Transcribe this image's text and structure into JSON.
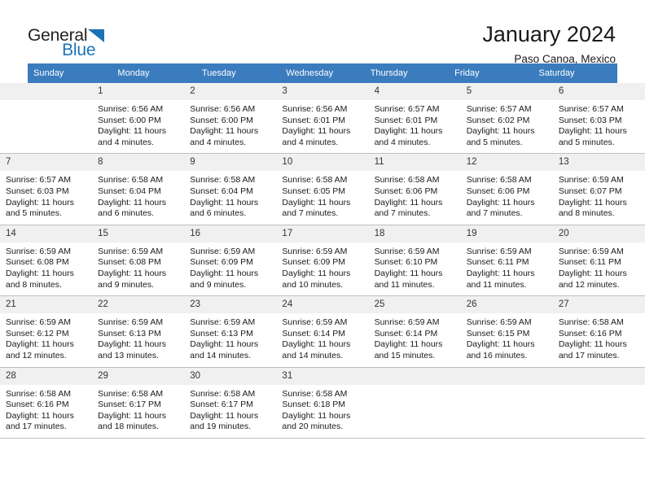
{
  "brand": {
    "name_part1": "General",
    "name_part2": "Blue",
    "triangle_color": "#1A73B7",
    "text_color": "#231F20"
  },
  "header": {
    "title": "January 2024",
    "subtitle": "Paso Canoa, Mexico",
    "header_bg_color": "#3A7CBE",
    "header_text_color": "#FFFFFF",
    "daynum_bg_color": "#F0F0F0"
  },
  "columns": [
    "Sunday",
    "Monday",
    "Tuesday",
    "Wednesday",
    "Thursday",
    "Friday",
    "Saturday"
  ],
  "weeks": [
    [
      {
        "day": "",
        "sunrise": "",
        "sunset": "",
        "daylight_line1": "",
        "daylight_line2": "",
        "empty": true
      },
      {
        "day": "1",
        "sunrise": "Sunrise: 6:56 AM",
        "sunset": "Sunset: 6:00 PM",
        "daylight_line1": "Daylight: 11 hours",
        "daylight_line2": "and 4 minutes."
      },
      {
        "day": "2",
        "sunrise": "Sunrise: 6:56 AM",
        "sunset": "Sunset: 6:00 PM",
        "daylight_line1": "Daylight: 11 hours",
        "daylight_line2": "and 4 minutes."
      },
      {
        "day": "3",
        "sunrise": "Sunrise: 6:56 AM",
        "sunset": "Sunset: 6:01 PM",
        "daylight_line1": "Daylight: 11 hours",
        "daylight_line2": "and 4 minutes."
      },
      {
        "day": "4",
        "sunrise": "Sunrise: 6:57 AM",
        "sunset": "Sunset: 6:01 PM",
        "daylight_line1": "Daylight: 11 hours",
        "daylight_line2": "and 4 minutes."
      },
      {
        "day": "5",
        "sunrise": "Sunrise: 6:57 AM",
        "sunset": "Sunset: 6:02 PM",
        "daylight_line1": "Daylight: 11 hours",
        "daylight_line2": "and 5 minutes."
      },
      {
        "day": "6",
        "sunrise": "Sunrise: 6:57 AM",
        "sunset": "Sunset: 6:03 PM",
        "daylight_line1": "Daylight: 11 hours",
        "daylight_line2": "and 5 minutes."
      }
    ],
    [
      {
        "day": "7",
        "sunrise": "Sunrise: 6:57 AM",
        "sunset": "Sunset: 6:03 PM",
        "daylight_line1": "Daylight: 11 hours",
        "daylight_line2": "and 5 minutes."
      },
      {
        "day": "8",
        "sunrise": "Sunrise: 6:58 AM",
        "sunset": "Sunset: 6:04 PM",
        "daylight_line1": "Daylight: 11 hours",
        "daylight_line2": "and 6 minutes."
      },
      {
        "day": "9",
        "sunrise": "Sunrise: 6:58 AM",
        "sunset": "Sunset: 6:04 PM",
        "daylight_line1": "Daylight: 11 hours",
        "daylight_line2": "and 6 minutes."
      },
      {
        "day": "10",
        "sunrise": "Sunrise: 6:58 AM",
        "sunset": "Sunset: 6:05 PM",
        "daylight_line1": "Daylight: 11 hours",
        "daylight_line2": "and 7 minutes."
      },
      {
        "day": "11",
        "sunrise": "Sunrise: 6:58 AM",
        "sunset": "Sunset: 6:06 PM",
        "daylight_line1": "Daylight: 11 hours",
        "daylight_line2": "and 7 minutes."
      },
      {
        "day": "12",
        "sunrise": "Sunrise: 6:58 AM",
        "sunset": "Sunset: 6:06 PM",
        "daylight_line1": "Daylight: 11 hours",
        "daylight_line2": "and 7 minutes."
      },
      {
        "day": "13",
        "sunrise": "Sunrise: 6:59 AM",
        "sunset": "Sunset: 6:07 PM",
        "daylight_line1": "Daylight: 11 hours",
        "daylight_line2": "and 8 minutes."
      }
    ],
    [
      {
        "day": "14",
        "sunrise": "Sunrise: 6:59 AM",
        "sunset": "Sunset: 6:08 PM",
        "daylight_line1": "Daylight: 11 hours",
        "daylight_line2": "and 8 minutes."
      },
      {
        "day": "15",
        "sunrise": "Sunrise: 6:59 AM",
        "sunset": "Sunset: 6:08 PM",
        "daylight_line1": "Daylight: 11 hours",
        "daylight_line2": "and 9 minutes."
      },
      {
        "day": "16",
        "sunrise": "Sunrise: 6:59 AM",
        "sunset": "Sunset: 6:09 PM",
        "daylight_line1": "Daylight: 11 hours",
        "daylight_line2": "and 9 minutes."
      },
      {
        "day": "17",
        "sunrise": "Sunrise: 6:59 AM",
        "sunset": "Sunset: 6:09 PM",
        "daylight_line1": "Daylight: 11 hours",
        "daylight_line2": "and 10 minutes."
      },
      {
        "day": "18",
        "sunrise": "Sunrise: 6:59 AM",
        "sunset": "Sunset: 6:10 PM",
        "daylight_line1": "Daylight: 11 hours",
        "daylight_line2": "and 11 minutes."
      },
      {
        "day": "19",
        "sunrise": "Sunrise: 6:59 AM",
        "sunset": "Sunset: 6:11 PM",
        "daylight_line1": "Daylight: 11 hours",
        "daylight_line2": "and 11 minutes."
      },
      {
        "day": "20",
        "sunrise": "Sunrise: 6:59 AM",
        "sunset": "Sunset: 6:11 PM",
        "daylight_line1": "Daylight: 11 hours",
        "daylight_line2": "and 12 minutes."
      }
    ],
    [
      {
        "day": "21",
        "sunrise": "Sunrise: 6:59 AM",
        "sunset": "Sunset: 6:12 PM",
        "daylight_line1": "Daylight: 11 hours",
        "daylight_line2": "and 12 minutes."
      },
      {
        "day": "22",
        "sunrise": "Sunrise: 6:59 AM",
        "sunset": "Sunset: 6:13 PM",
        "daylight_line1": "Daylight: 11 hours",
        "daylight_line2": "and 13 minutes."
      },
      {
        "day": "23",
        "sunrise": "Sunrise: 6:59 AM",
        "sunset": "Sunset: 6:13 PM",
        "daylight_line1": "Daylight: 11 hours",
        "daylight_line2": "and 14 minutes."
      },
      {
        "day": "24",
        "sunrise": "Sunrise: 6:59 AM",
        "sunset": "Sunset: 6:14 PM",
        "daylight_line1": "Daylight: 11 hours",
        "daylight_line2": "and 14 minutes."
      },
      {
        "day": "25",
        "sunrise": "Sunrise: 6:59 AM",
        "sunset": "Sunset: 6:14 PM",
        "daylight_line1": "Daylight: 11 hours",
        "daylight_line2": "and 15 minutes."
      },
      {
        "day": "26",
        "sunrise": "Sunrise: 6:59 AM",
        "sunset": "Sunset: 6:15 PM",
        "daylight_line1": "Daylight: 11 hours",
        "daylight_line2": "and 16 minutes."
      },
      {
        "day": "27",
        "sunrise": "Sunrise: 6:58 AM",
        "sunset": "Sunset: 6:16 PM",
        "daylight_line1": "Daylight: 11 hours",
        "daylight_line2": "and 17 minutes."
      }
    ],
    [
      {
        "day": "28",
        "sunrise": "Sunrise: 6:58 AM",
        "sunset": "Sunset: 6:16 PM",
        "daylight_line1": "Daylight: 11 hours",
        "daylight_line2": "and 17 minutes."
      },
      {
        "day": "29",
        "sunrise": "Sunrise: 6:58 AM",
        "sunset": "Sunset: 6:17 PM",
        "daylight_line1": "Daylight: 11 hours",
        "daylight_line2": "and 18 minutes."
      },
      {
        "day": "30",
        "sunrise": "Sunrise: 6:58 AM",
        "sunset": "Sunset: 6:17 PM",
        "daylight_line1": "Daylight: 11 hours",
        "daylight_line2": "and 19 minutes."
      },
      {
        "day": "31",
        "sunrise": "Sunrise: 6:58 AM",
        "sunset": "Sunset: 6:18 PM",
        "daylight_line1": "Daylight: 11 hours",
        "daylight_line2": "and 20 minutes."
      },
      {
        "day": "",
        "sunrise": "",
        "sunset": "",
        "daylight_line1": "",
        "daylight_line2": "",
        "empty": true
      },
      {
        "day": "",
        "sunrise": "",
        "sunset": "",
        "daylight_line1": "",
        "daylight_line2": "",
        "empty": true
      },
      {
        "day": "",
        "sunrise": "",
        "sunset": "",
        "daylight_line1": "",
        "daylight_line2": "",
        "empty": true
      }
    ]
  ]
}
